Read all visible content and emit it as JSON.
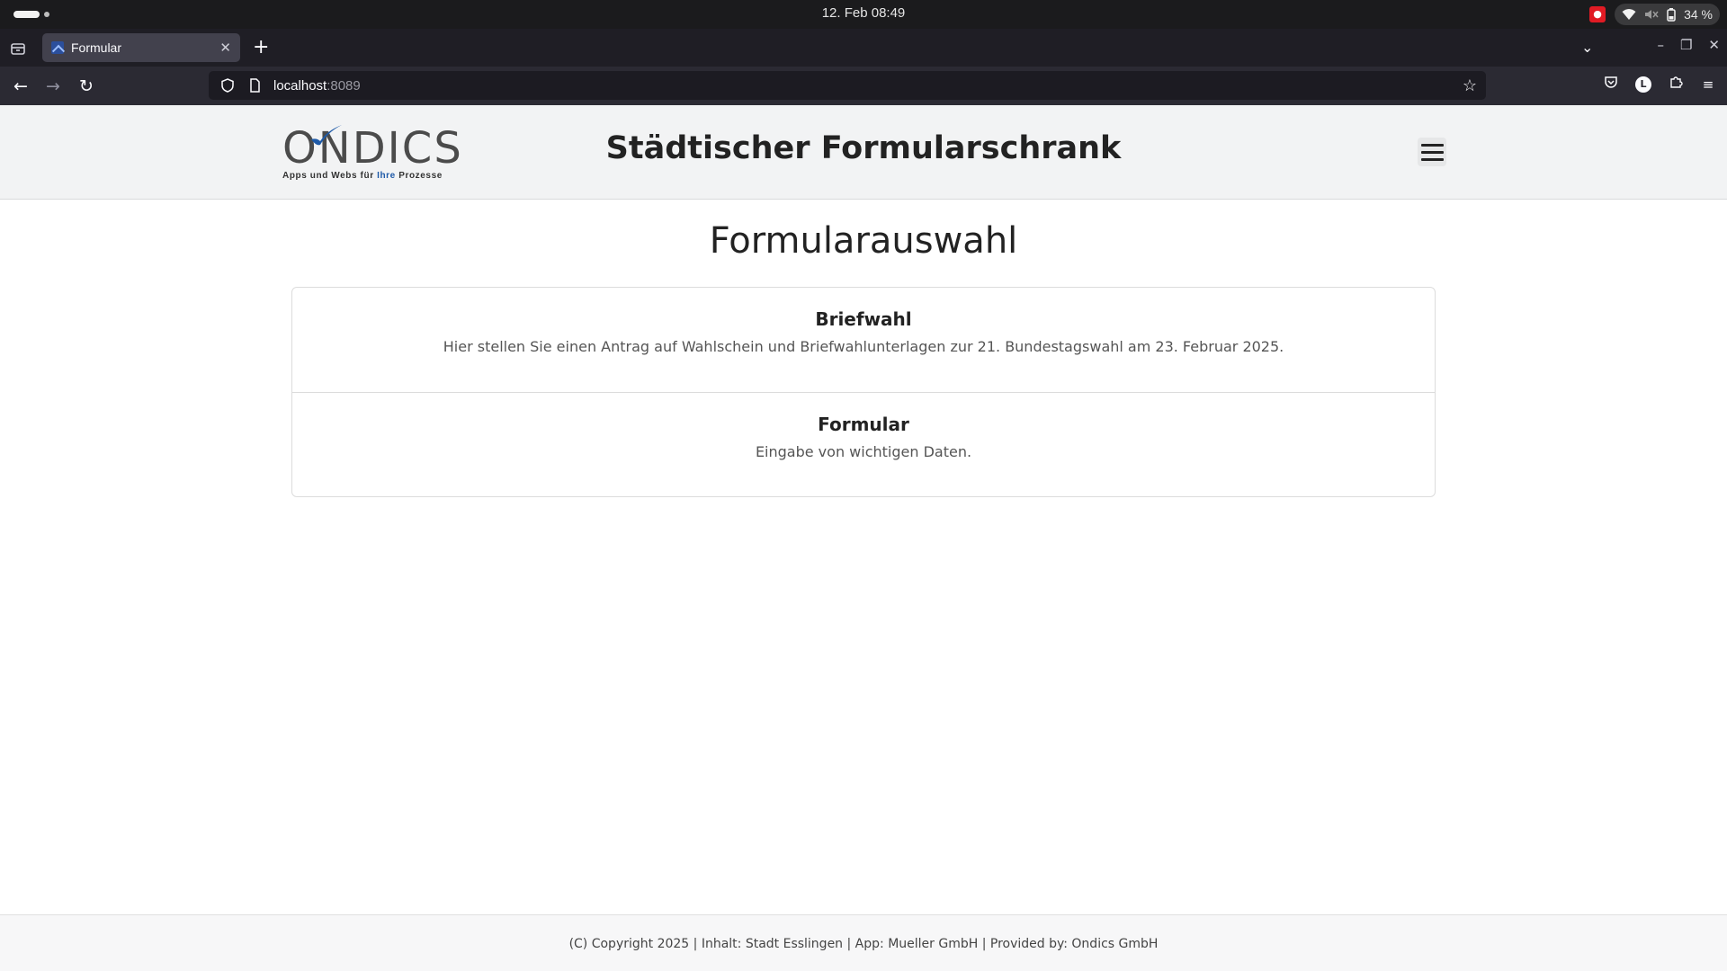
{
  "os": {
    "clock": "12. Feb  08:49",
    "battery": "34 %"
  },
  "browser": {
    "tab_title": "Formular",
    "url_host": "localhost",
    "url_port": ":8089"
  },
  "header": {
    "logo_word": "ONDICS",
    "logo_tag_prefix": "Apps und Webs für ",
    "logo_tag_highlight": "Ihre",
    "logo_tag_suffix": " Prozesse",
    "site_title": "Städtischer Formularschrank"
  },
  "main": {
    "heading": "Formularauswahl",
    "forms": [
      {
        "title": "Briefwahl",
        "description": "Hier stellen Sie einen Antrag auf Wahlschein und Briefwahlunterlagen zur 21. Bundestagswahl am 23. Februar 2025."
      },
      {
        "title": "Formular",
        "description": "Eingabe von wichtigen Daten."
      }
    ]
  },
  "footer": {
    "text": "(C) Copyright 2025 | Inhalt: Stadt Esslingen | App: Mueller GmbH | Provided by: Ondics GmbH"
  },
  "colors": {
    "header_bg": "#f2f3f4",
    "logo_blue": "#1e5aa8",
    "browser_chrome": "#2b2a33"
  }
}
